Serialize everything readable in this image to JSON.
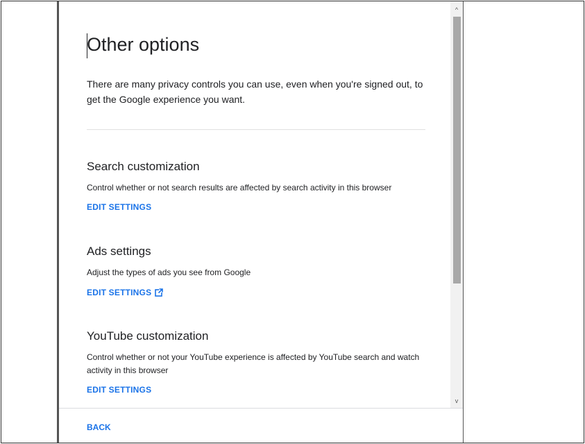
{
  "dialog": {
    "title": "Other options",
    "intro": "There are many privacy controls you can use, even when you're signed out, to get the Google experience you want.",
    "sections": [
      {
        "title": "Search customization",
        "description": "Control whether or not search results are affected by search activity in this browser",
        "link_label": "EDIT SETTINGS",
        "external": false
      },
      {
        "title": "Ads settings",
        "description": "Adjust the types of ads you see from Google",
        "link_label": "EDIT SETTINGS",
        "external": true,
        "external_icon": "open-in-new-icon"
      },
      {
        "title": "YouTube customization",
        "description": "Control whether or not your YouTube experience is affected by YouTube search and watch activity in this browser",
        "link_label": "EDIT SETTINGS",
        "external": false
      }
    ],
    "footer": {
      "back_label": "BACK"
    }
  },
  "scrollbar": {
    "up_icon": "chevron-up-icon",
    "down_icon": "chevron-down-icon",
    "up_glyph": "^",
    "down_glyph": "v"
  },
  "colors": {
    "link": "#1a73e8",
    "text": "#202124",
    "divider": "#e0e0e0"
  }
}
